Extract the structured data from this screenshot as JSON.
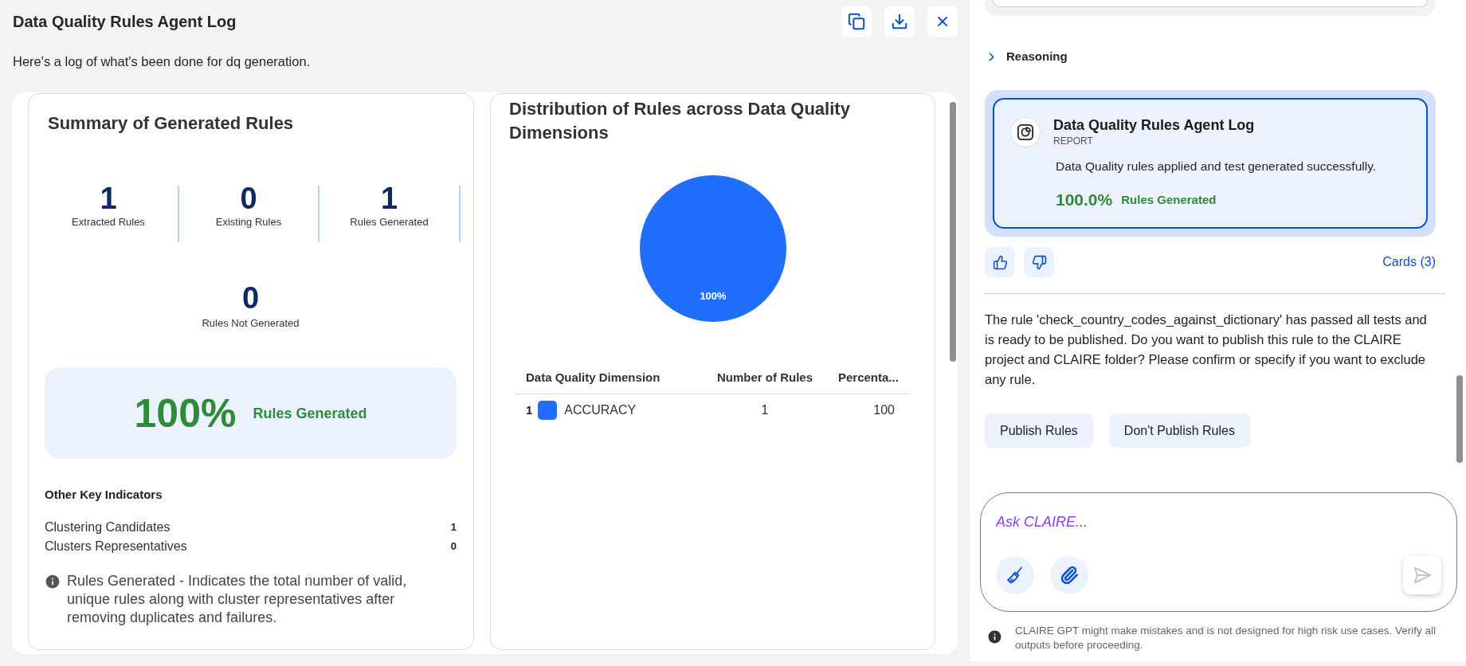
{
  "header": {
    "title": "Data Quality Rules Agent Log",
    "subtitle": "Here's a log of what's been done for dq generation."
  },
  "summary": {
    "title": "Summary of Generated Rules",
    "stats": [
      {
        "value": "1",
        "label": "Extracted Rules"
      },
      {
        "value": "0",
        "label": "Existing Rules"
      },
      {
        "value": "1",
        "label": "Rules Generated"
      },
      {
        "value": "0",
        "label": "Rules Not Generated"
      }
    ],
    "highlight": {
      "value": "100%",
      "label": "Rules Generated"
    },
    "indicators_title": "Other Key Indicators",
    "indicators": [
      {
        "label": "Clustering Candidates",
        "value": "1"
      },
      {
        "label": "Clusters Representatives",
        "value": "0"
      }
    ],
    "note": "Rules Generated - Indicates the total number of valid, unique rules along with cluster representatives after removing duplicates and failures."
  },
  "distribution": {
    "title": "Distribution of Rules across Data Quality Dimensions",
    "chart_data": {
      "type": "pie",
      "values": [
        100
      ],
      "value_labels": [
        "100%"
      ]
    },
    "table": {
      "columns": [
        "Data Quality Dimension",
        "Number of Rules",
        "Percenta..."
      ],
      "rows": [
        {
          "index": "1",
          "color": "#1f6ffc",
          "dimension": "ACCURACY",
          "rules": "1",
          "percentage": "100"
        }
      ]
    }
  },
  "chat": {
    "reasoning": {
      "label": "Reasoning",
      "expanded": false
    },
    "report_card": {
      "title": "Data Quality Rules Agent Log",
      "type_label": "REPORT",
      "description": "Data Quality rules applied and test generated successfully.",
      "percent": "100.0%",
      "percent_label": "Rules Generated",
      "selected": true
    },
    "cards_link": "Cards (3)",
    "message": "The rule 'check_country_codes_against_dictionary' has passed all tests and is ready to be published. Do you want to publish this rule to the CLAIRE project and CLAIRE folder? Please confirm or specify if you want to exclude any rule.",
    "actions": [
      "Publish Rules",
      "Don't Publish Rules"
    ],
    "input": {
      "placeholder": "Ask CLAIRE..."
    },
    "send": {
      "disabled": true
    },
    "disclaimer": "CLAIRE GPT might make mistakes and is not designed for high risk use cases. Verify all outputs before proceeding."
  }
}
